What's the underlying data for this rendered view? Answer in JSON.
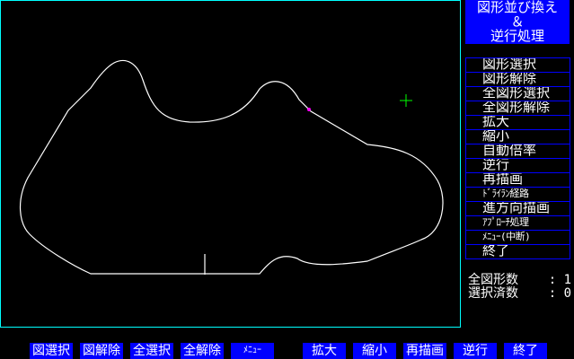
{
  "title": {
    "line1": "図形並び換え",
    "line2": "＆",
    "line3": "逆行処理"
  },
  "menu": {
    "items": [
      {
        "label": "図形選択"
      },
      {
        "label": "図形解除"
      },
      {
        "label": "全図形選択"
      },
      {
        "label": "全図形解除"
      },
      {
        "label": "拡大"
      },
      {
        "label": "縮小"
      },
      {
        "label": "自動倍率"
      },
      {
        "label": "逆行"
      },
      {
        "label": "再描画"
      },
      {
        "label": "ﾄﾞﾗｲﾗﾝ経路"
      },
      {
        "label": "進方向描画"
      },
      {
        "label": "ｱﾌﾟﾛｰﾁ処理"
      },
      {
        "label": "ﾒﾆｭｰ(中断)"
      },
      {
        "label": "終了"
      }
    ]
  },
  "stats": {
    "total_label": "全図形数",
    "total_sep": ":",
    "total_value": "1",
    "selected_label": "選択済数",
    "selected_sep": ":",
    "selected_value": "0"
  },
  "function_keys": [
    {
      "label": "図選択"
    },
    {
      "label": "図解除"
    },
    {
      "label": "全選択"
    },
    {
      "label": "全解除"
    },
    {
      "label": "ﾒﾆｭｰ"
    },
    {
      "label": "拡大"
    },
    {
      "label": "縮小"
    },
    {
      "label": "再描画"
    },
    {
      "label": "逆行"
    },
    {
      "label": "終了"
    }
  ],
  "colors": {
    "background": "#000000",
    "border": "#00ffff",
    "menu_blue": "#0000ff",
    "shape": "#ffffff",
    "cursor": "#00ff00",
    "marker": "#ff00ff"
  },
  "icons": {
    "cursor": "crosshair-cursor-icon"
  }
}
